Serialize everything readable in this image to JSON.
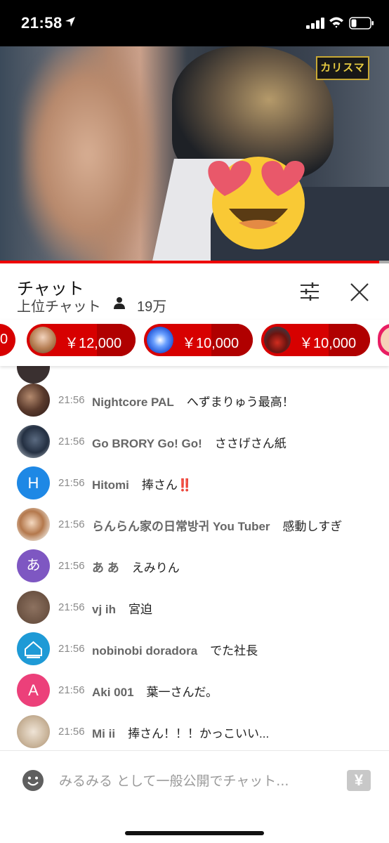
{
  "status_bar": {
    "time": "21:58"
  },
  "video": {
    "logo_text": "カリスマ"
  },
  "chat_header": {
    "title": "チャット",
    "mode": "上位チャット",
    "viewer_count": "19万"
  },
  "tickers": [
    {
      "amount": "0"
    },
    {
      "amount": "￥12,000"
    },
    {
      "amount": "￥10,000"
    },
    {
      "amount": "￥10,000"
    }
  ],
  "messages": [
    {
      "time": "21:56",
      "author": "Nightcore PAL",
      "text": "へずまりゅう最高！"
    },
    {
      "time": "21:56",
      "author": "Go BRORY Go! Go!",
      "text": "ささげさん紙"
    },
    {
      "time": "21:56",
      "author": "Hitomi",
      "text": "捧さん",
      "badge": "‼️"
    },
    {
      "time": "21:56",
      "author": "らんらん家の日常방귀 You Tuber",
      "text": "感動しすぎ"
    },
    {
      "time": "21:56",
      "author": "あ あ",
      "text": "えみりん"
    },
    {
      "time": "21:56",
      "author": "vj ih",
      "text": "宮迫"
    },
    {
      "time": "21:56",
      "author": "nobinobi doradora",
      "text": "でた社長"
    },
    {
      "time": "21:56",
      "author": "Aki 001",
      "text": "葉一さんだ。"
    },
    {
      "time": "21:56",
      "author": "Mi ii",
      "text": "捧さん！！！かっこいい..."
    }
  ],
  "avatars": {
    "hitomi_letter": "H",
    "aa_letter": "あ",
    "aki_letter": "A"
  },
  "input": {
    "placeholder": "みるみる として一般公開でチャット...",
    "yen_label": "¥"
  },
  "colors": {
    "accent": "#d70000",
    "hitomi_avatar": "#1e88e5",
    "aa_avatar": "#7e57c2",
    "aki_avatar": "#ec407a"
  }
}
